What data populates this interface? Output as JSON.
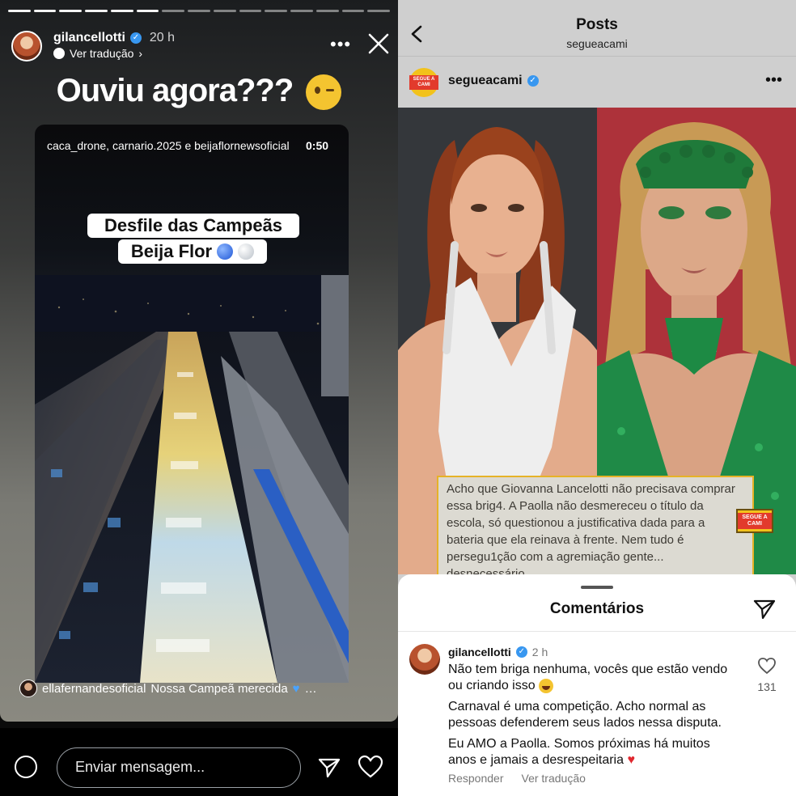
{
  "story": {
    "username": "gilancellotti",
    "time": "20 h",
    "translate_label": "Ver tradução",
    "headline": "Ouviu agora???",
    "headline_emoji": "wink-emoji",
    "video_credit": "caca_drone, carnario.2025 e beijaflornewsoficial",
    "video_timer": "0:50",
    "video_caption_line1": "Desfile das Campeãs",
    "video_caption_line2": "Beija Flor",
    "reply_user": "ellafernandesoficial",
    "reply_text": "Nossa Campeã merecida",
    "reply_suffix": "…",
    "message_placeholder": "Enviar mensagem...",
    "progress_total": 15,
    "progress_done": 6
  },
  "post": {
    "header_title": "Posts",
    "header_subtitle": "segueacami",
    "username": "segueacami",
    "logo_text": "SEGUE A CAMI",
    "caption": "Acho que Giovanna Lancelotti não precisava comprar essa brig4. A Paolla não desmereceu o título da escola, só questionou a justificativa dada para a bateria que ela reinava à frente. Nem tudo é persegu1ção com a agremiação gente... desnecessário"
  },
  "comments": {
    "sheet_title": "Comentários",
    "items": [
      {
        "user": "gilancellotti",
        "time": "2 h",
        "p1": "Não tem briga nenhuma, vocês que estão vendo ou criando isso",
        "p2": "Carnaval é uma competição. Acho normal as pessoas defenderem seus lados nessa disputa.",
        "p3": "Eu AMO a Paolla. Somos próximas há muitos anos e jamais a desrespeitaria",
        "likes": "131",
        "reply_label": "Responder",
        "translate_label": "Ver tradução"
      }
    ]
  },
  "colors": {
    "verified": "#3897f0",
    "brand_yellow": "#f2c21b",
    "brand_red": "#e23a2c"
  }
}
